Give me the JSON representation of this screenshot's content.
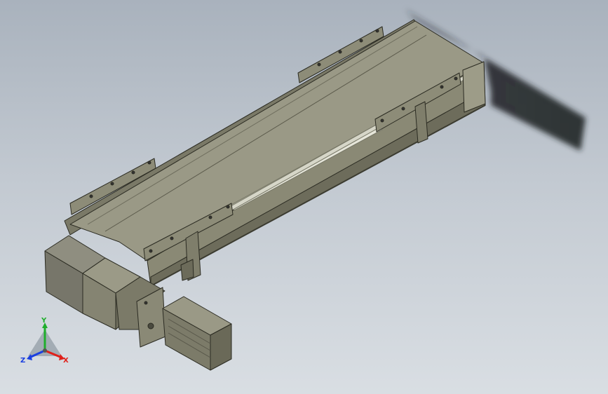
{
  "triad": {
    "x_label": "X",
    "y_label": "Y",
    "z_label": "Z",
    "x_color": "#e0201a",
    "y_color": "#1fae2c",
    "z_color": "#1a3fe0"
  },
  "model": {
    "body_color": "#8e8d7a",
    "edge_color": "#2b2b22"
  }
}
